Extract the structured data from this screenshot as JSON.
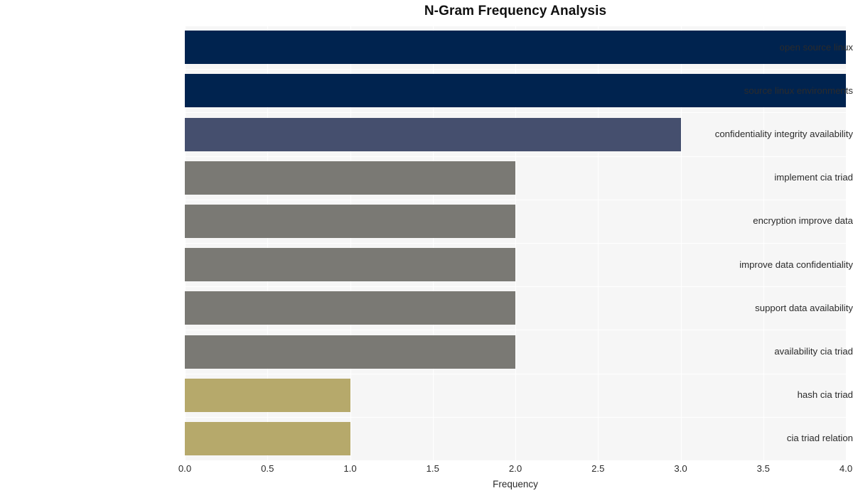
{
  "chart_data": {
    "type": "bar",
    "orientation": "horizontal",
    "title": "N-Gram Frequency Analysis",
    "xlabel": "Frequency",
    "ylabel": "",
    "categories": [
      "open source linux",
      "source linux environments",
      "confidentiality integrity availability",
      "implement cia triad",
      "encryption improve data",
      "improve data confidentiality",
      "support data availability",
      "availability cia triad",
      "hash cia triad",
      "cia triad relation"
    ],
    "values": [
      4,
      4,
      3,
      2,
      2,
      2,
      2,
      2,
      1,
      1
    ],
    "bar_colors": [
      "#00234f",
      "#00234f",
      "#454f6e",
      "#7a7974",
      "#7a7974",
      "#7a7974",
      "#7a7974",
      "#7a7974",
      "#b6a96b",
      "#b6a96b"
    ],
    "xlim": [
      0,
      4
    ],
    "xticks": [
      "0.0",
      "0.5",
      "1.0",
      "1.5",
      "2.0",
      "2.5",
      "3.0",
      "3.5",
      "4.0"
    ],
    "xtick_values": [
      0,
      0.5,
      1,
      1.5,
      2,
      2.5,
      3,
      3.5,
      4
    ],
    "grid": true,
    "grid_color": "#ffffff",
    "plot_background": "#f6f6f6",
    "figure_background": "#ffffff",
    "legend": null,
    "legend_position": "none"
  }
}
